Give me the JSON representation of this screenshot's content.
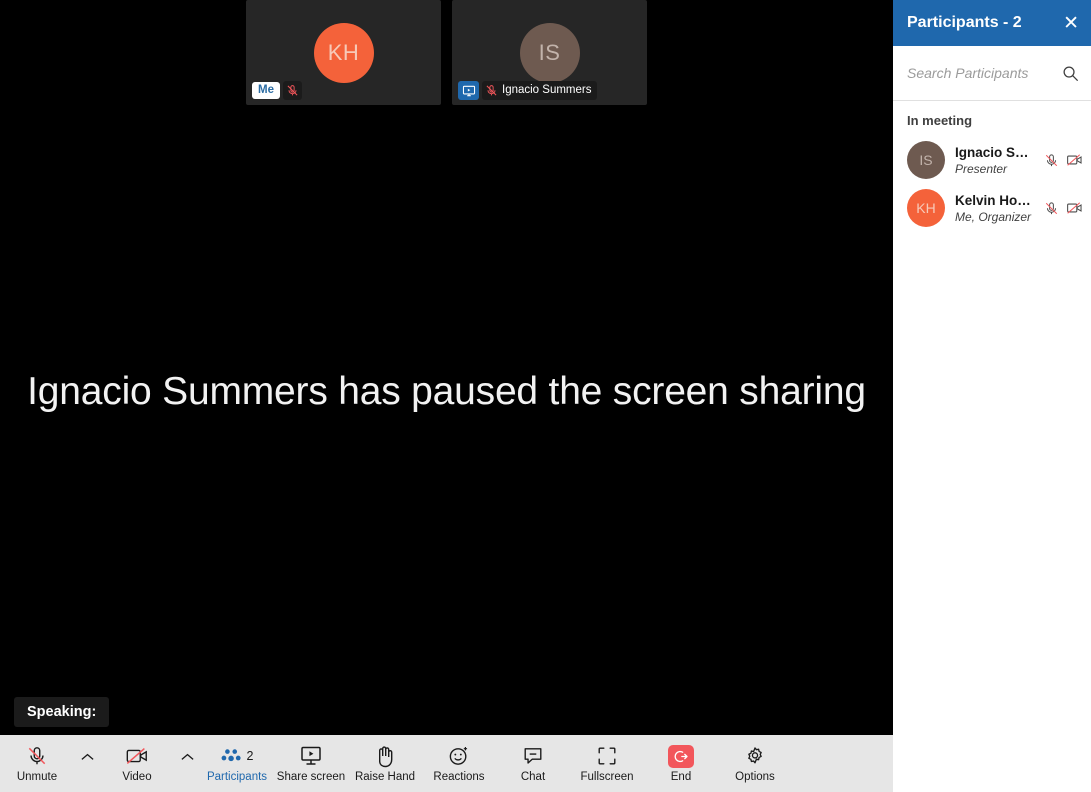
{
  "stage": {
    "paused_message": "Ignacio Summers has paused the screen sharing",
    "speaking_label": "Speaking:"
  },
  "filmstrip": {
    "tiles": [
      {
        "initials": "KH",
        "avatar_color": "#f4623a",
        "initials_color": "#f7c9b8",
        "badge_me": "Me",
        "muted": true,
        "sharing": false,
        "name": ""
      },
      {
        "initials": "IS",
        "avatar_color": "#6e5a50",
        "initials_color": "#c2b3ab",
        "badge_me": "",
        "muted": true,
        "sharing": true,
        "name": "Ignacio Summers"
      }
    ]
  },
  "toolbar": {
    "accent_color": "#1f68ad",
    "end_color": "#f2565b",
    "items": [
      {
        "label": "Unmute",
        "icon": "mic-muted-icon",
        "active": false,
        "caret": true,
        "count": ""
      },
      {
        "label": "Video",
        "icon": "camera-off-icon",
        "active": false,
        "caret": true,
        "count": ""
      },
      {
        "label": "Participants",
        "icon": "participants-icon",
        "active": true,
        "caret": false,
        "count": "2"
      },
      {
        "label": "Share screen",
        "icon": "share-screen-icon",
        "active": false,
        "caret": false,
        "count": ""
      },
      {
        "label": "Raise Hand",
        "icon": "raise-hand-icon",
        "active": false,
        "caret": false,
        "count": ""
      },
      {
        "label": "Reactions",
        "icon": "reactions-icon",
        "active": false,
        "caret": false,
        "count": ""
      },
      {
        "label": "Chat",
        "icon": "chat-icon",
        "active": false,
        "caret": false,
        "count": ""
      },
      {
        "label": "Fullscreen",
        "icon": "fullscreen-icon",
        "active": false,
        "caret": false,
        "count": ""
      },
      {
        "label": "End",
        "icon": "end-call-icon",
        "active": false,
        "caret": false,
        "count": ""
      },
      {
        "label": "Options",
        "icon": "gear-icon",
        "active": false,
        "caret": false,
        "count": ""
      }
    ]
  },
  "panel": {
    "header_color": "#1f68ad",
    "title": "Participants - 2",
    "close_icon": "✕",
    "search_placeholder": "Search Participants",
    "section_label": "In meeting",
    "participants": [
      {
        "initials": "IS",
        "avatar_color": "#6e5a50",
        "initials_color": "#c2b3ab",
        "name": "Ignacio Sum...",
        "role": "Presenter",
        "muted": true,
        "camera_off": true
      },
      {
        "initials": "KH",
        "avatar_color": "#f4623a",
        "initials_color": "#f7c9b8",
        "name": "Kelvin Hoff...",
        "role": "Me, Organizer",
        "muted": true,
        "camera_off": true
      }
    ]
  }
}
